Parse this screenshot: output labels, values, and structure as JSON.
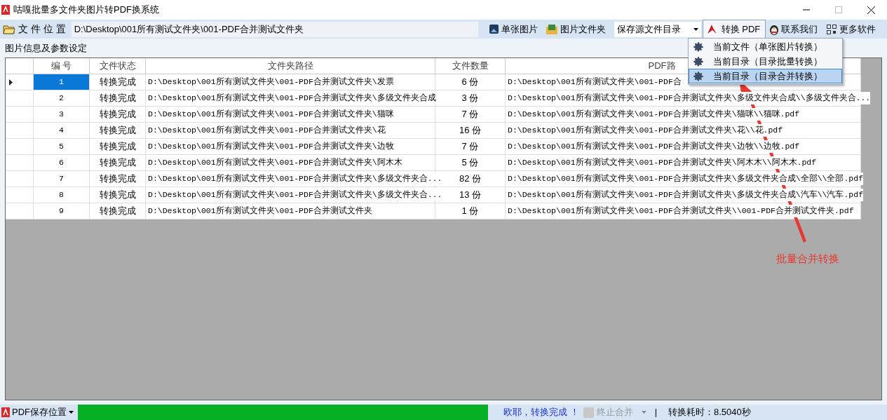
{
  "window": {
    "title": "咕嘎批量多文件夹图片转PDF换系统"
  },
  "toolbar": {
    "location_label": "文 件 位 置",
    "path": "D:\\Desktop\\001所有测试文件夹\\001-PDF合并测试文件夹",
    "buttons": [
      {
        "label": "单张图片",
        "kind": "image"
      },
      {
        "label": "图片文件夹",
        "kind": "folder"
      }
    ],
    "save_dropdown": "保存源文件目录",
    "convert_button": "转换 PDF",
    "contact_button": "联系我们",
    "more_button": "更多软件"
  },
  "convert_menu": [
    {
      "label": "当前文件（单张图片转换）",
      "selected": false
    },
    {
      "label": "当前目录（目录批量转换）",
      "selected": false
    },
    {
      "label": "当前目录（目录合并转换）",
      "selected": true
    }
  ],
  "group_title": "图片信息及参数设定",
  "table": {
    "columns": [
      "编 号",
      "文件状态",
      "文件夹路径",
      "文件数量",
      "PDF路"
    ],
    "rows": [
      {
        "current": true,
        "cells": [
          "1",
          "转换完成",
          "D:\\Desktop\\001所有测试文件夹\\001-PDF合并测试文件夹\\发票",
          "6 份",
          "D:\\Desktop\\001所有测试文件夹\\001-PDF合"
        ]
      },
      {
        "current": false,
        "cells": [
          "2",
          "转换完成",
          "D:\\Desktop\\001所有测试文件夹\\001-PDF合并测试文件夹\\多级文件夹合成",
          "3 份",
          "D:\\Desktop\\001所有测试文件夹\\001-PDF合并测试文件夹\\多级文件夹合成\\\\多级文件夹合..."
        ]
      },
      {
        "current": false,
        "cells": [
          "3",
          "转换完成",
          "D:\\Desktop\\001所有测试文件夹\\001-PDF合并测试文件夹\\猫咪",
          "7 份",
          "D:\\Desktop\\001所有测试文件夹\\001-PDF合并测试文件夹\\猫咪\\\\猫咪.pdf"
        ]
      },
      {
        "current": false,
        "cells": [
          "4",
          "转换完成",
          "D:\\Desktop\\001所有测试文件夹\\001-PDF合并测试文件夹\\花",
          "16 份",
          "D:\\Desktop\\001所有测试文件夹\\001-PDF合并测试文件夹\\花\\\\花.pdf"
        ]
      },
      {
        "current": false,
        "cells": [
          "5",
          "转换完成",
          "D:\\Desktop\\001所有测试文件夹\\001-PDF合并测试文件夹\\边牧",
          "7 份",
          "D:\\Desktop\\001所有测试文件夹\\001-PDF合并测试文件夹\\边牧\\\\边牧.pdf"
        ]
      },
      {
        "current": false,
        "cells": [
          "6",
          "转换完成",
          "D:\\Desktop\\001所有测试文件夹\\001-PDF合并测试文件夹\\阿木木",
          "5 份",
          "D:\\Desktop\\001所有测试文件夹\\001-PDF合并测试文件夹\\阿木木\\\\阿木木.pdf"
        ]
      },
      {
        "current": false,
        "cells": [
          "7",
          "转换完成",
          "D:\\Desktop\\001所有测试文件夹\\001-PDF合并测试文件夹\\多级文件夹合...",
          "82 份",
          "D:\\Desktop\\001所有测试文件夹\\001-PDF合并测试文件夹\\多级文件夹合成\\全部\\\\全部.pdf"
        ]
      },
      {
        "current": false,
        "cells": [
          "8",
          "转换完成",
          "D:\\Desktop\\001所有测试文件夹\\001-PDF合并测试文件夹\\多级文件夹合...",
          "13 份",
          "D:\\Desktop\\001所有测试文件夹\\001-PDF合并测试文件夹\\多级文件夹合成\\汽车\\\\汽车.pdf"
        ]
      },
      {
        "current": false,
        "cells": [
          "9",
          "转换完成",
          "D:\\Desktop\\001所有测试文件夹\\001-PDF合并测试文件夹",
          "1 份",
          "D:\\Desktop\\001所有测试文件夹\\001-PDF合并测试文件夹\\\\001-PDF合并测试文件夹.pdf"
        ]
      }
    ]
  },
  "annotation": "批量合并转换",
  "status_bar": {
    "save_location": "PDF保存位置",
    "progress": {
      "level": 1
    },
    "message": "欧耶，转换完成 ！",
    "stop_button": {
      "label": "终止合并",
      "disabled": true
    },
    "separator": "|",
    "elapsed": "转换耗时：8.5040秒"
  }
}
